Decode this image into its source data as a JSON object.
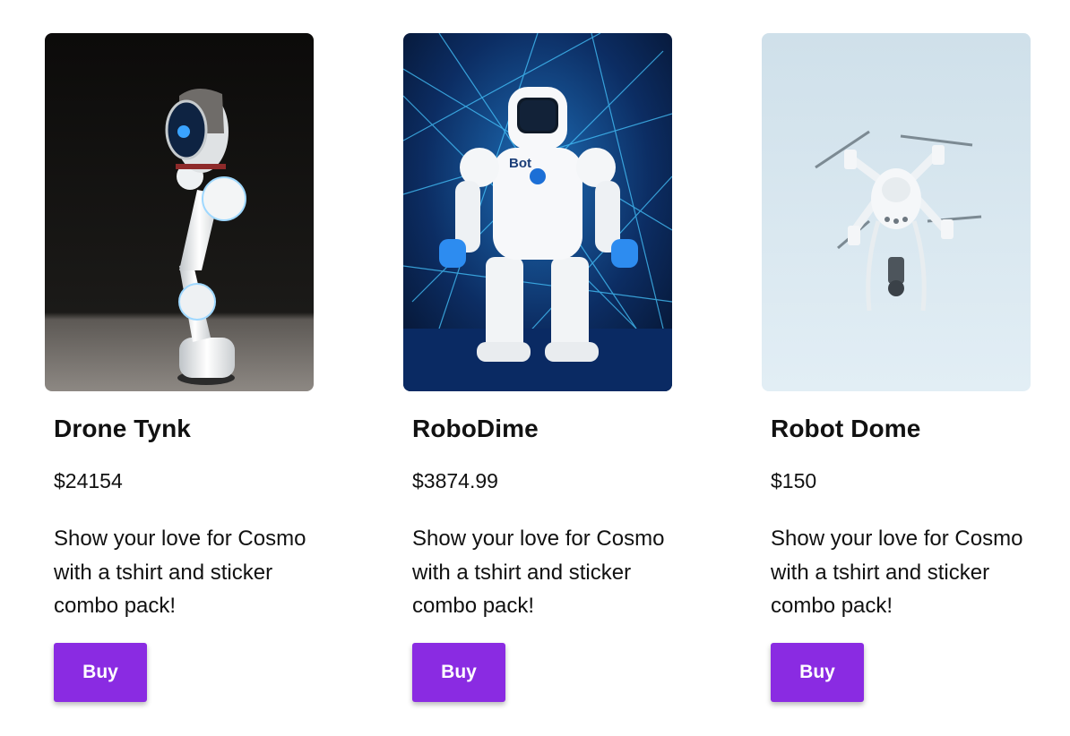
{
  "accent_color": "#8a2be2",
  "products": [
    {
      "name": "Drone Tynk",
      "price": "$24154",
      "description": "Show your love for Cosmo with a tshirt and sticker combo pack!",
      "buy_label": "Buy",
      "image_icon": "robot-arm-image"
    },
    {
      "name": "RoboDime",
      "price": "$3874.99",
      "description": "Show your love for Cosmo with a tshirt and sticker combo pack!",
      "buy_label": "Buy",
      "image_icon": "humanoid-robot-image",
      "image_text": "Bot"
    },
    {
      "name": "Robot Dome",
      "price": "$150",
      "description": "Show your love for Cosmo with a tshirt and sticker combo pack!",
      "buy_label": "Buy",
      "image_icon": "drone-image"
    }
  ]
}
